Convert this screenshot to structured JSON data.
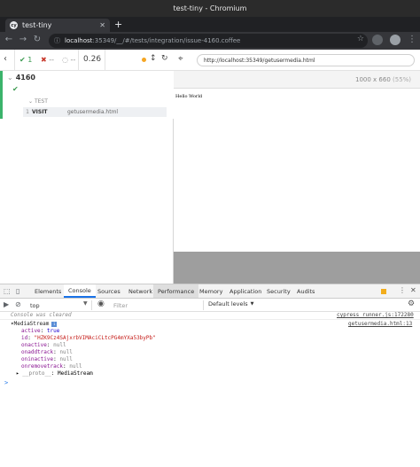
{
  "window": {
    "title": "test-tiny - Chromium"
  },
  "browser": {
    "tab_title": "test-tiny",
    "new_tab_symbol": "+",
    "url_host": "localhost",
    "url_path": ":35349/__/#/tests/integration/issue-4160.coffee",
    "colors": {
      "titlebar": "#2b2b2b",
      "toolbar": "#35363a",
      "tabstrip": "#202124"
    }
  },
  "reporter": {
    "stats": {
      "passed": "1",
      "failed": "--",
      "pending": "--"
    },
    "duration": "0.26",
    "suite_name": "4160",
    "test_label": "TEST",
    "command": {
      "number": "1",
      "name": "VISIT",
      "message": "getusermedia.html"
    },
    "colors": {
      "pass": "#3bb36b",
      "fail": "#c7382b",
      "auto_scroll": "#f5a623"
    }
  },
  "aut": {
    "url": "http://localhost:35349/getusermedia.html",
    "viewport": "1000 x 660",
    "scale": "(55%)",
    "page_text": "Hello World"
  },
  "devtools": {
    "tabs": [
      "Elements",
      "Console",
      "Sources",
      "Network",
      "Performance",
      "Memory",
      "Application",
      "Security",
      "Audits"
    ],
    "active_tab": "Console",
    "console": {
      "context": "top",
      "filter_placeholder": "Filter",
      "levels": "Default levels",
      "messages": [
        {
          "text": "Console was cleared",
          "source": "cypress_runner.js:172280"
        },
        {
          "text": "MediaStream",
          "source": "getusermedia.html:13"
        }
      ],
      "props": [
        {
          "key": "active",
          "value": "true",
          "type": "bool"
        },
        {
          "key": "id",
          "value": "\"HZK9Cz4SAjxrbVIMAciCLtcPG4mYXa53byPb\"",
          "type": "string"
        },
        {
          "key": "onactive",
          "value": "null",
          "type": "null"
        },
        {
          "key": "onaddtrack",
          "value": "null",
          "type": "null"
        },
        {
          "key": "oninactive",
          "value": "null",
          "type": "null"
        },
        {
          "key": "onremovetrack",
          "value": "null",
          "type": "null"
        }
      ],
      "proto": {
        "key": "__proto__",
        "value": "MediaStream"
      },
      "prompt": ">"
    }
  }
}
